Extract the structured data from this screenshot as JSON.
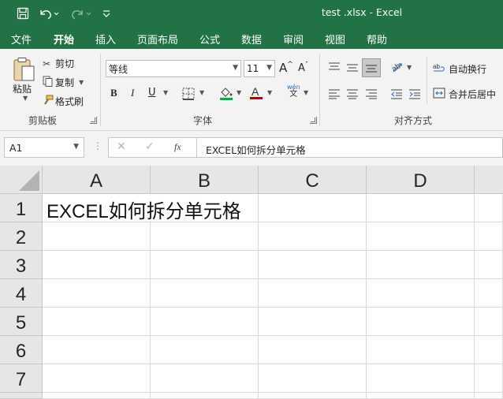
{
  "window": {
    "title": "test .xlsx  -  Excel"
  },
  "quick_access": {
    "save": "save-icon",
    "undo": "undo-icon",
    "redo": "redo-icon",
    "customize": "customize-icon"
  },
  "menu": [
    "文件",
    "开始",
    "插入",
    "页面布局",
    "公式",
    "数据",
    "审阅",
    "视图",
    "帮助"
  ],
  "ribbon": {
    "clipboard": {
      "label": "剪贴板",
      "paste": "粘贴",
      "cut": "剪切",
      "copy": "复制",
      "format_painter": "格式刷"
    },
    "font": {
      "label": "字体",
      "font_name": "等线",
      "font_size": "11",
      "bold": "B",
      "italic": "I",
      "underline": "U",
      "grow": "A",
      "shrink": "A",
      "phonetic_top": "wén",
      "phonetic_bottom": "文"
    },
    "alignment": {
      "label": "对齐方式",
      "wrap_text": "自动换行",
      "merge_center": "合并后居中"
    }
  },
  "formula_bar": {
    "name_box": "A1",
    "fx": "fx",
    "content": "EXCEL如何拆分单元格"
  },
  "sheet": {
    "columns": [
      "A",
      "B",
      "C",
      "D"
    ],
    "rows": [
      "1",
      "2",
      "3",
      "4",
      "5",
      "6",
      "7"
    ],
    "cells": {
      "A1": "EXCEL如何拆分单元格"
    }
  },
  "colors": {
    "brand": "#217346",
    "font_color": "#c00000",
    "fill_color": "#00b050"
  }
}
